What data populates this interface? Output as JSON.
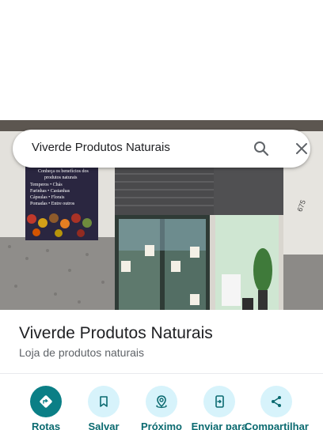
{
  "search": {
    "query": "Viverde Produtos Naturais"
  },
  "place": {
    "name": "Viverde Produtos Naturais",
    "category": "Loja de produtos naturais"
  },
  "photo": {
    "sign_lines": [
      "Conheça os benefícios dos",
      "produtos naturais",
      "Temperos  • Chás",
      "Farinhas  • Castanhas",
      "Cápsulas  • Florais",
      "Pomadas  • Entre outros"
    ],
    "house_number": "675"
  },
  "actions": [
    {
      "label": "Rotas",
      "icon": "directions-icon"
    },
    {
      "label": "Salvar",
      "icon": "bookmark-icon"
    },
    {
      "label": "Próximo",
      "icon": "nearby-icon"
    },
    {
      "label": "Enviar para",
      "icon": "send-to-phone-icon"
    },
    {
      "label": "Compartilhar",
      "icon": "share-icon"
    }
  ],
  "colors": {
    "primary": "#0b7f86",
    "action_bg": "#d7f3fb",
    "action_label": "#0b6a70"
  }
}
